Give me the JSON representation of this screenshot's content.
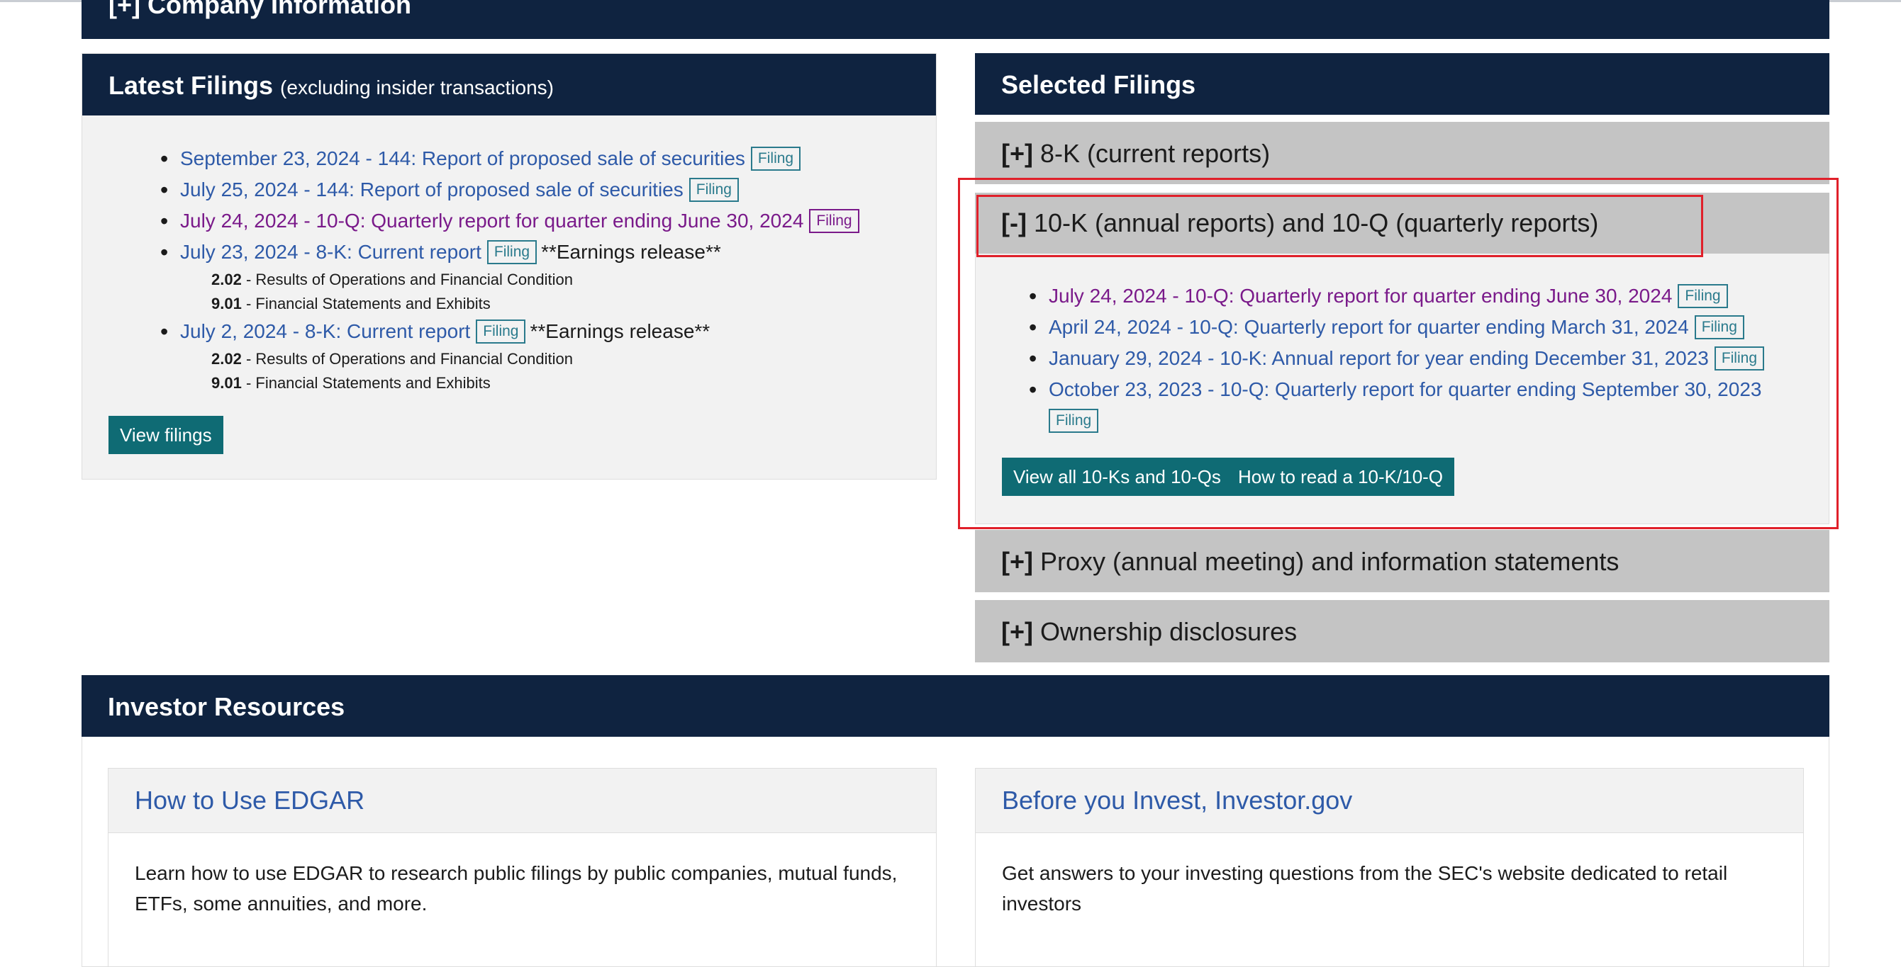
{
  "company_info": {
    "title": "[+] Company Information"
  },
  "latest_filings": {
    "title": "Latest Filings",
    "subtitle": "(excluding insider transactions)",
    "items": [
      {
        "link": "September 23, 2024 - 144: Report of proposed sale of securities",
        "badge": "Filing",
        "note": "",
        "visited": false,
        "sub_items": []
      },
      {
        "link": "July 25, 2024 - 144: Report of proposed sale of securities",
        "badge": "Filing",
        "note": "",
        "visited": false,
        "sub_items": []
      },
      {
        "link": "July 24, 2024 - 10-Q: Quarterly report for quarter ending June 30, 2024",
        "badge": "Filing",
        "note": "",
        "visited": true,
        "sub_items": []
      },
      {
        "link": "July 23, 2024 - 8-K: Current report",
        "badge": "Filing",
        "note": "**Earnings release**",
        "visited": false,
        "sub_items": [
          {
            "code": "2.02",
            "desc": " - Results of Operations and Financial Condition"
          },
          {
            "code": "9.01",
            "desc": " - Financial Statements and Exhibits"
          }
        ]
      },
      {
        "link": "July 2, 2024 - 8-K: Current report",
        "badge": "Filing",
        "note": "**Earnings release**",
        "visited": false,
        "sub_items": [
          {
            "code": "2.02",
            "desc": " - Results of Operations and Financial Condition"
          },
          {
            "code": "9.01",
            "desc": " - Financial Statements and Exhibits"
          }
        ]
      }
    ],
    "view_button": "View filings"
  },
  "selected_filings": {
    "title": "Selected Filings",
    "sections": {
      "eight_k": {
        "toggle": "[+]",
        "label": "8-K (current reports)"
      },
      "ten_k": {
        "toggle": "[-]",
        "label": "10-K (annual reports) and 10-Q (quarterly reports)",
        "items": [
          {
            "link": "July 24, 2024 - 10-Q: Quarterly report for quarter ending June 30, 2024",
            "badge": "Filing",
            "visited": true
          },
          {
            "link": "April 24, 2024 - 10-Q: Quarterly report for quarter ending March 31, 2024",
            "badge": "Filing",
            "visited": false
          },
          {
            "link": "January 29, 2024 - 10-K: Annual report for year ending December 31, 2023",
            "badge": "Filing",
            "visited": false
          },
          {
            "link": "October 23, 2023 - 10-Q: Quarterly report for quarter ending September 30, 2023",
            "badge": "Filing",
            "visited": false
          }
        ],
        "view_all_button": "View all 10-Ks and 10-Qs",
        "how_to_button": "How to read a 10-K/10-Q"
      },
      "proxy": {
        "toggle": "[+]",
        "label": "Proxy (annual meeting) and information statements"
      },
      "ownership": {
        "toggle": "[+]",
        "label": "Ownership disclosures"
      }
    }
  },
  "investor_resources": {
    "title": "Investor Resources",
    "cards": [
      {
        "title": "How to Use EDGAR",
        "text": "Learn how to use EDGAR to research public filings by public companies, mutual funds, ETFs, some annuities, and more."
      },
      {
        "title": "Before you Invest, Investor.gov",
        "text": "Get answers to your investing questions from the SEC's website dedicated to retail investors"
      }
    ]
  },
  "colors": {
    "navy": "#0f2340",
    "link": "#2e5aa8",
    "visited": "#7a1a8a",
    "button": "#0f6b74",
    "highlight": "#e0202a"
  }
}
